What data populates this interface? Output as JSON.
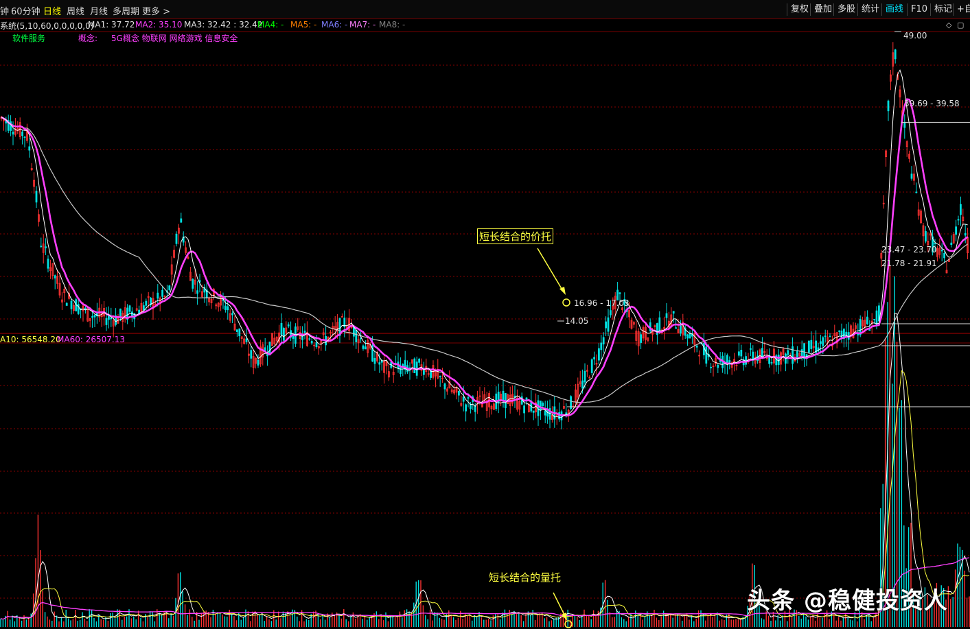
{
  "toolbar": {
    "timeframes": [
      {
        "label": "钟",
        "active": false
      },
      {
        "label": "60分钟",
        "active": false
      },
      {
        "label": "日线",
        "active": true
      },
      {
        "label": "周线",
        "active": false
      },
      {
        "label": "月线",
        "active": false
      },
      {
        "label": "多周期",
        "active": false
      },
      {
        "label": "更多 >",
        "active": false
      }
    ],
    "right_buttons": [
      {
        "label": "复权",
        "active": false
      },
      {
        "label": "叠加",
        "active": false
      },
      {
        "label": "多股",
        "active": false
      },
      {
        "label": "统计",
        "active": false
      },
      {
        "label": "画线",
        "active": true
      },
      {
        "label": "F10",
        "active": false
      },
      {
        "label": "标记",
        "active": false
      },
      {
        "label": "+自",
        "active": false
      }
    ]
  },
  "ma_legend": {
    "system": "系统(5,10,60,0,0,0,0,0)",
    "items": [
      {
        "text": "MA1: 37.72",
        "color": "#e0e0e0"
      },
      {
        "text": "MA2: 35.10",
        "color": "#ff40ff"
      },
      {
        "text": "MA3: 32.42 : 32.42",
        "color": "#e0e0e0"
      },
      {
        "text": "MA4: -",
        "color": "#00ff00"
      },
      {
        "text": "MA5: -",
        "color": "#ff8000"
      },
      {
        "text": "MA6: -",
        "color": "#8080ff"
      },
      {
        "text": "MA7: -",
        "color": "#ff80ff"
      },
      {
        "text": "MA8: -",
        "color": "#808080"
      }
    ]
  },
  "sector": {
    "industry": "软件服务",
    "concept_label": "概念:",
    "concepts": "5G概念 物联网 网络游戏 信息安全"
  },
  "volume_legend": {
    "ma10": "A10: 56548.20",
    "ma60": "MA60: 26507.13"
  },
  "price_marks": {
    "high": "49.00",
    "low": "14.05",
    "levels": [
      {
        "text": "39.69 - 39.58",
        "value": 39.6
      },
      {
        "text": "23.47 - 23.70",
        "value": 23.6
      },
      {
        "text": "21.78 - 21.91",
        "value": 21.85
      },
      {
        "text": "16.96 - 17.03",
        "value": 17.0
      }
    ]
  },
  "annotations": {
    "price_support": "短长结合的价托",
    "volume_support": "短长结合的量托"
  },
  "watermark": "头条 @稳健投资人",
  "colors": {
    "up": "#ff3232",
    "down": "#00e0e0",
    "ma_short": "#ff40ff",
    "ma_long": "#c8c8c8",
    "ma_mid": "#ffffff",
    "grid": "#8a0000",
    "volume_ma": "#ffff40"
  },
  "chart_data": {
    "type": "candlestick",
    "price_range": [
      12,
      50
    ],
    "series": [
      {
        "name": "MA1",
        "values": []
      },
      {
        "name": "MA2",
        "values": []
      },
      {
        "name": "MA3",
        "values": []
      }
    ],
    "key_points": [
      {
        "label": "high",
        "value": 49.0
      },
      {
        "label": "low",
        "value": 14.05
      }
    ]
  }
}
